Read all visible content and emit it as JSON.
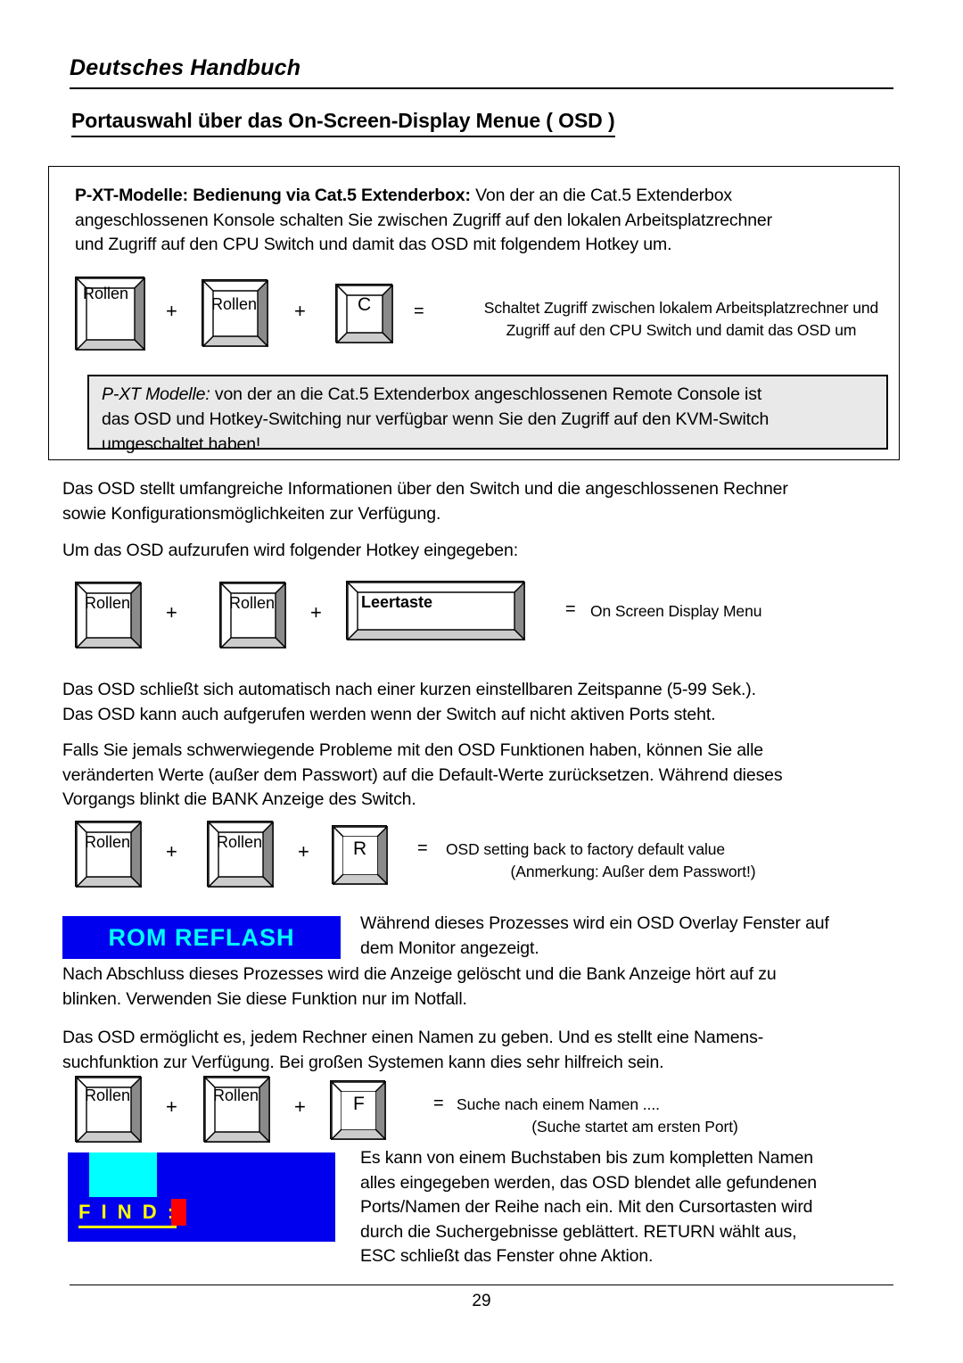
{
  "header": {
    "running_title": "Deutsches Handbuch",
    "section_title": "Portauswahl über das On-Screen-Display Menue ( OSD )"
  },
  "framed_block": {
    "intro_bold": "P-XT-Modelle: Bedienung via Cat.5 Extenderbox:",
    "intro_rest": "  Von der an die Cat.5 Extenderbox\nangeschlossenen Konsole schalten Sie zwischen Zugriff auf den lokalen Arbeitsplatzrechner\nund Zugriff auf den CPU Switch und damit das OSD mit folgendem Hotkey um.",
    "hotkey": {
      "key1": "Rollen",
      "plus1": "+",
      "key2": "Rollen",
      "plus2": "+",
      "key3": "C",
      "equals": "=",
      "description": "Schaltet Zugriff zwischen lokalem Arbeitsplatzrechner und\nZugriff auf den CPU Switch und damit das OSD um"
    },
    "note": {
      "bold_italic_lead": "P-XT Modelle:",
      "rest": " von der  an die Cat.5 Extenderbox angeschlossenen Remote Console ist\ndas OSD und Hotkey-Switching nur verfügbar wenn Sie den Zugriff auf den KVM-Switch\numgeschaltet haben!"
    }
  },
  "body": {
    "p1": "Das OSD stellt umfangreiche Informationen über den Switch und die angeschlossenen Rechner\nsowie Konfigurationsmöglichkeiten zur Verfügung.",
    "p2": "Um das OSD aufzurufen wird folgender Hotkey eingegeben:",
    "hotkey_osd": {
      "key1": "Rollen",
      "plus1": "+",
      "key2": "Rollen",
      "plus2": "+",
      "key3": "Leertaste",
      "equals": "=",
      "description": "On Screen Display Menu"
    },
    "p3": "Das OSD schließt sich automatisch nach einer kurzen einstellbaren Zeitspanne (5-99 Sek.).\nDas OSD kann auch aufgerufen werden wenn der Switch auf nicht aktiven Ports steht.",
    "p4": "Falls Sie jemals schwerwiegende Probleme mit den OSD Funktionen haben, können Sie alle\nveränderten Werte (außer dem Passwort) auf die Default-Werte zurücksetzen. Während dieses\nVorgangs blinkt die BANK Anzeige des Switch.",
    "hotkey_reset": {
      "key1": "Rollen",
      "plus1": "+",
      "key2": "Rollen",
      "plus2": "+",
      "key3": "R",
      "equals": "=",
      "description": "OSD setting back to factory default value",
      "description2": "(Anmerkung: Außer dem Passwort!)"
    },
    "rom_banner": {
      "label": "ROM  REFLASH",
      "bg_color": "#0000ee",
      "text_color": "#00ffff"
    },
    "p5": "Während dieses Prozesses wird ein OSD Overlay Fenster auf\ndem Monitor angezeigt.",
    "p6": "Nach Abschluss dieses Prozesses wird die Anzeige gelöscht und die Bank Anzeige hört auf zu\nblinken. Verwenden Sie diese Funktion nur im Notfall.",
    "p7": "Das OSD ermöglicht es, jedem Rechner einen Namen zu geben. Und es stellt eine Namens-\nsuchfunktion zur Verfügung. Bei großen Systemen kann dies sehr hilfreich sein.",
    "hotkey_find": {
      "key1": "Rollen",
      "plus1": "+",
      "key2": "Rollen",
      "plus2": "+",
      "key3": "F",
      "equals": "=",
      "description": "Suche nach einem Namen ....",
      "description2": "(Suche startet am ersten Port)"
    },
    "find_window": {
      "label": "F I N D :",
      "bg_color": "#0000ee",
      "highlight_color": "#00ffff",
      "label_color": "#ffff00",
      "cursor_color": "#ff0000"
    },
    "p8": "Es kann von einem Buchstaben bis zum kompletten Namen\nalles eingegeben werden, das OSD blendet alle gefundenen\nPorts/Namen der Reihe nach ein. Mit den Cursortasten wird\ndurch die Suchergebnisse geblättert. RETURN wählt aus,\nESC schließt das Fenster ohne Aktion."
  },
  "footer": {
    "page_number": "29"
  }
}
